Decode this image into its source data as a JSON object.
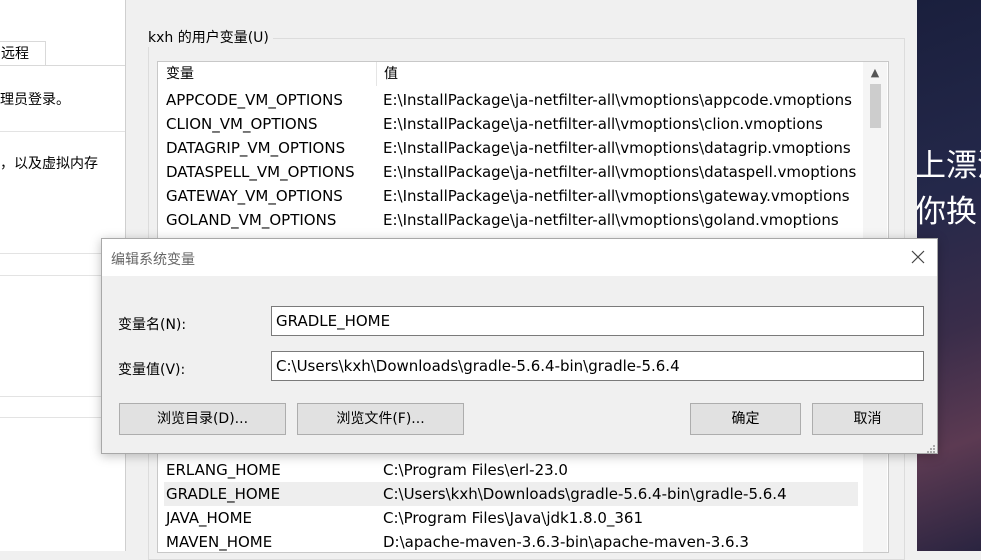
{
  "left_window": {
    "tab_label": "远程",
    "text1": "理员登录。",
    "text2": "，以及虚拟内存"
  },
  "env_window": {
    "group_title": "kxh 的用户变量(U)",
    "columns": [
      "变量",
      "值"
    ],
    "rows_top": [
      {
        "name": "APPCODE_VM_OPTIONS",
        "value": "E:\\InstallPackage\\ja-netfilter-all\\vmoptions\\appcode.vmoptions"
      },
      {
        "name": "CLION_VM_OPTIONS",
        "value": "E:\\InstallPackage\\ja-netfilter-all\\vmoptions\\clion.vmoptions"
      },
      {
        "name": "DATAGRIP_VM_OPTIONS",
        "value": "E:\\InstallPackage\\ja-netfilter-all\\vmoptions\\datagrip.vmoptions"
      },
      {
        "name": "DATASPELL_VM_OPTIONS",
        "value": "E:\\InstallPackage\\ja-netfilter-all\\vmoptions\\dataspell.vmoptions"
      },
      {
        "name": "GATEWAY_VM_OPTIONS",
        "value": "E:\\InstallPackage\\ja-netfilter-all\\vmoptions\\gateway.vmoptions"
      },
      {
        "name": "GOLAND_VM_OPTIONS",
        "value": "E:\\InstallPackage\\ja-netfilter-all\\vmoptions\\goland.vmoptions"
      }
    ],
    "rows_bottom": [
      {
        "name": "ERLANG_HOME",
        "value": "C:\\Program Files\\erl-23.0"
      },
      {
        "name": "GRADLE_HOME",
        "value": "C:\\Users\\kxh\\Downloads\\gradle-5.6.4-bin\\gradle-5.6.4"
      },
      {
        "name": "JAVA_HOME",
        "value": "C:\\Program Files\\Java\\jdk1.8.0_361"
      },
      {
        "name": "MAVEN_HOME",
        "value": "D:\\apache-maven-3.6.3-bin\\apache-maven-3.6.3"
      }
    ]
  },
  "desktop": {
    "text1": "上漂流",
    "text2": "你换"
  },
  "dialog": {
    "title": "编辑系统变量",
    "name_label": "变量名(N):",
    "name_value": "GRADLE_HOME",
    "value_label": "变量值(V):",
    "value_value": "C:\\Users\\kxh\\Downloads\\gradle-5.6.4-bin\\gradle-5.6.4",
    "browse_dir_label": "浏览目录(D)...",
    "browse_file_label": "浏览文件(F)...",
    "ok_label": "确定",
    "cancel_label": "取消",
    "close_icon": "close-icon"
  }
}
